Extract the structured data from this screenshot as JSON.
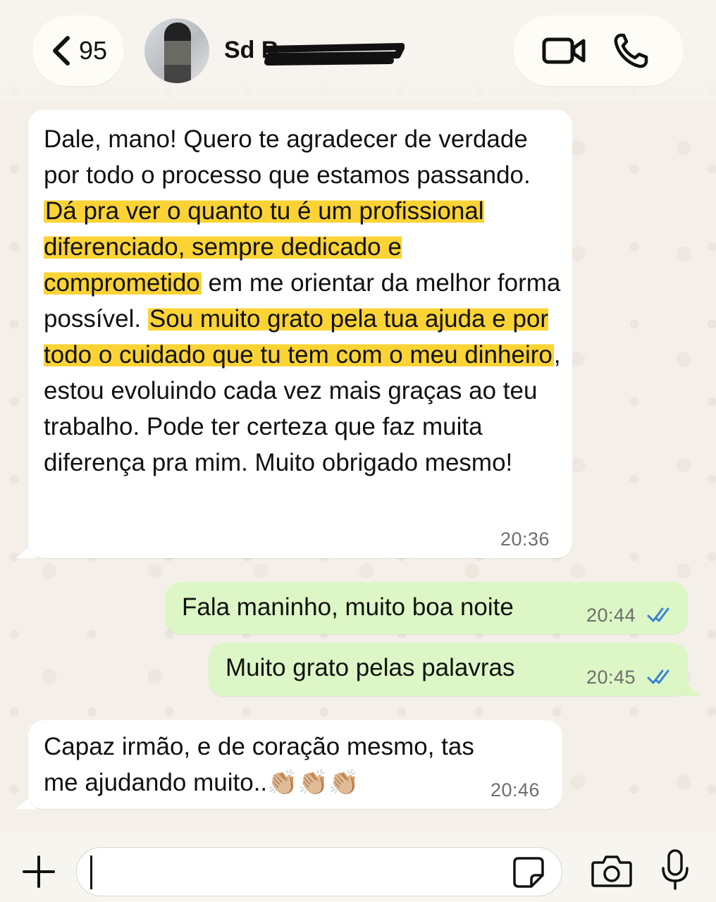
{
  "header": {
    "back_count": "95",
    "contact_name": "Sd B",
    "icons": [
      "chevron-left-icon",
      "video-call-icon",
      "phone-icon"
    ]
  },
  "messages": [
    {
      "direction": "incoming",
      "segments": [
        {
          "text": "Dale, mano! Quero te agradecer de verdade por todo o processo que estamos passando. ",
          "highlight": false
        },
        {
          "text": "Dá pra ver o quanto tu é um profissional diferenciado, sempre dedicado e comprometido",
          "highlight": true
        },
        {
          "text": " em me orientar da melhor forma possível. ",
          "highlight": false
        },
        {
          "text": "Sou muito grato pela tua ajuda e por todo o cuidado que tu tem com o meu dinheiro",
          "highlight": true
        },
        {
          "text": ", estou evoluindo cada vez mais graças ao teu trabalho. Pode ter certeza que faz muita diferença pra mim. Muito obrigado mesmo!",
          "highlight": false
        }
      ],
      "time": "20:36"
    },
    {
      "direction": "outgoing",
      "text": "Fala maninho, muito boa noite",
      "time": "20:44",
      "status": "read"
    },
    {
      "direction": "outgoing",
      "text": "Muito grato pelas palavras",
      "time": "20:45",
      "status": "read"
    },
    {
      "direction": "incoming",
      "text": "Capaz irmão, e de coração mesmo, tas me ajudando muito..👏🏼👏🏼👏🏼",
      "time": "20:46"
    }
  ],
  "composer": {
    "input_value": "",
    "icons": [
      "plus-icon",
      "sticker-icon",
      "camera-icon",
      "microphone-icon"
    ]
  },
  "colors": {
    "incoming_bubble": "#ffffff",
    "outgoing_bubble": "#dcf7c5",
    "highlight": "#fbd335",
    "read_ticks": "#3b82d6",
    "wallpaper": "#f4f0e9"
  }
}
